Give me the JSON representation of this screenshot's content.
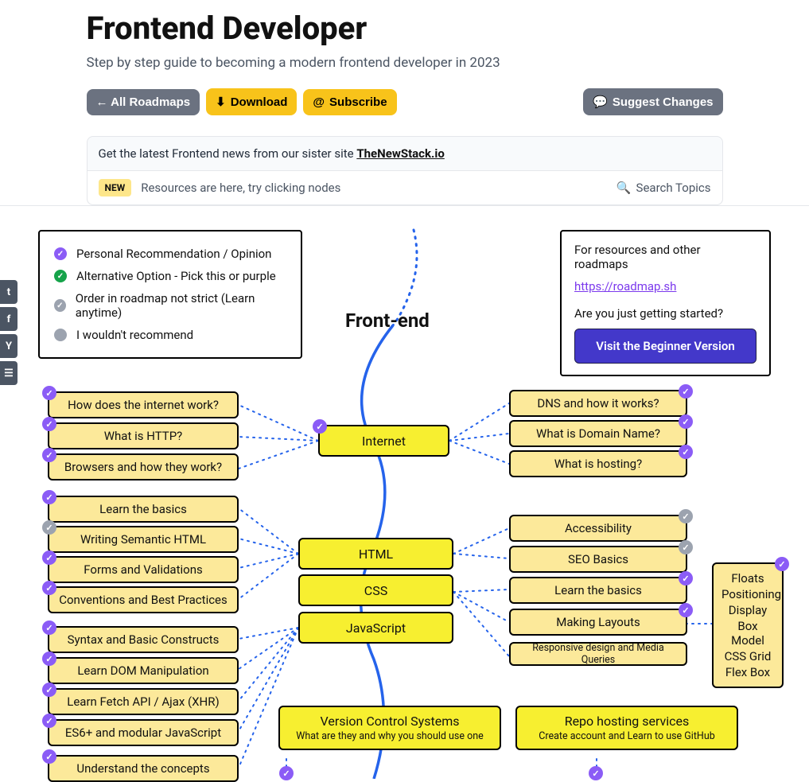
{
  "header": {
    "title": "Frontend Developer",
    "subtitle": "Step by step guide to becoming a modern frontend developer in 2023",
    "buttons": {
      "all_roadmaps": "← All Roadmaps",
      "download": "Download",
      "subscribe": "Subscribe",
      "suggest": "Suggest Changes"
    }
  },
  "news": {
    "pre": "Get the latest Frontend news from our sister site ",
    "link": "TheNewStack.io",
    "pill": "NEW",
    "msg": "Resources are here, try clicking nodes",
    "search": "Search Topics"
  },
  "legend": {
    "items": [
      "Personal Recommendation / Opinion",
      "Alternative Option - Pick this or purple",
      "Order in roadmap not strict (Learn anytime)",
      "I wouldn't recommend"
    ]
  },
  "resources": {
    "title": "For resources and other roadmaps",
    "link": "https://roadmap.sh",
    "question": "Are you just getting started?",
    "cta": "Visit the Beginner Version"
  },
  "title_main": "Front-end",
  "centers": {
    "internet": "Internet",
    "html": "HTML",
    "css": "CSS",
    "js": "JavaScript"
  },
  "internet_left": [
    "How does the internet work?",
    "What is HTTP?",
    "Browsers and how they work?"
  ],
  "internet_right": [
    "DNS and how it works?",
    "What is Domain Name?",
    "What is hosting?"
  ],
  "html_left": [
    "Learn the basics",
    "Writing Semantic HTML",
    "Forms and Validations",
    "Conventions and Best Practices"
  ],
  "html_right": [
    "Accessibility",
    "SEO Basics"
  ],
  "css_right": [
    "Learn the basics",
    "Making Layouts",
    "Responsive design and Media Queries"
  ],
  "js_left": [
    "Syntax and Basic Constructs",
    "Learn DOM Manipulation",
    "Learn Fetch API / Ajax (XHR)",
    "ES6+ and modular JavaScript",
    "Understand the concepts"
  ],
  "layouts_list": [
    "Floats",
    "Positioning",
    "Display",
    "Box Model",
    "CSS Grid",
    "Flex Box"
  ],
  "vcs": {
    "title": "Version Control Systems",
    "sub": "What are they and why you should use one"
  },
  "repo": {
    "title": "Repo hosting services",
    "sub": "Create account and Learn to use GitHub"
  }
}
